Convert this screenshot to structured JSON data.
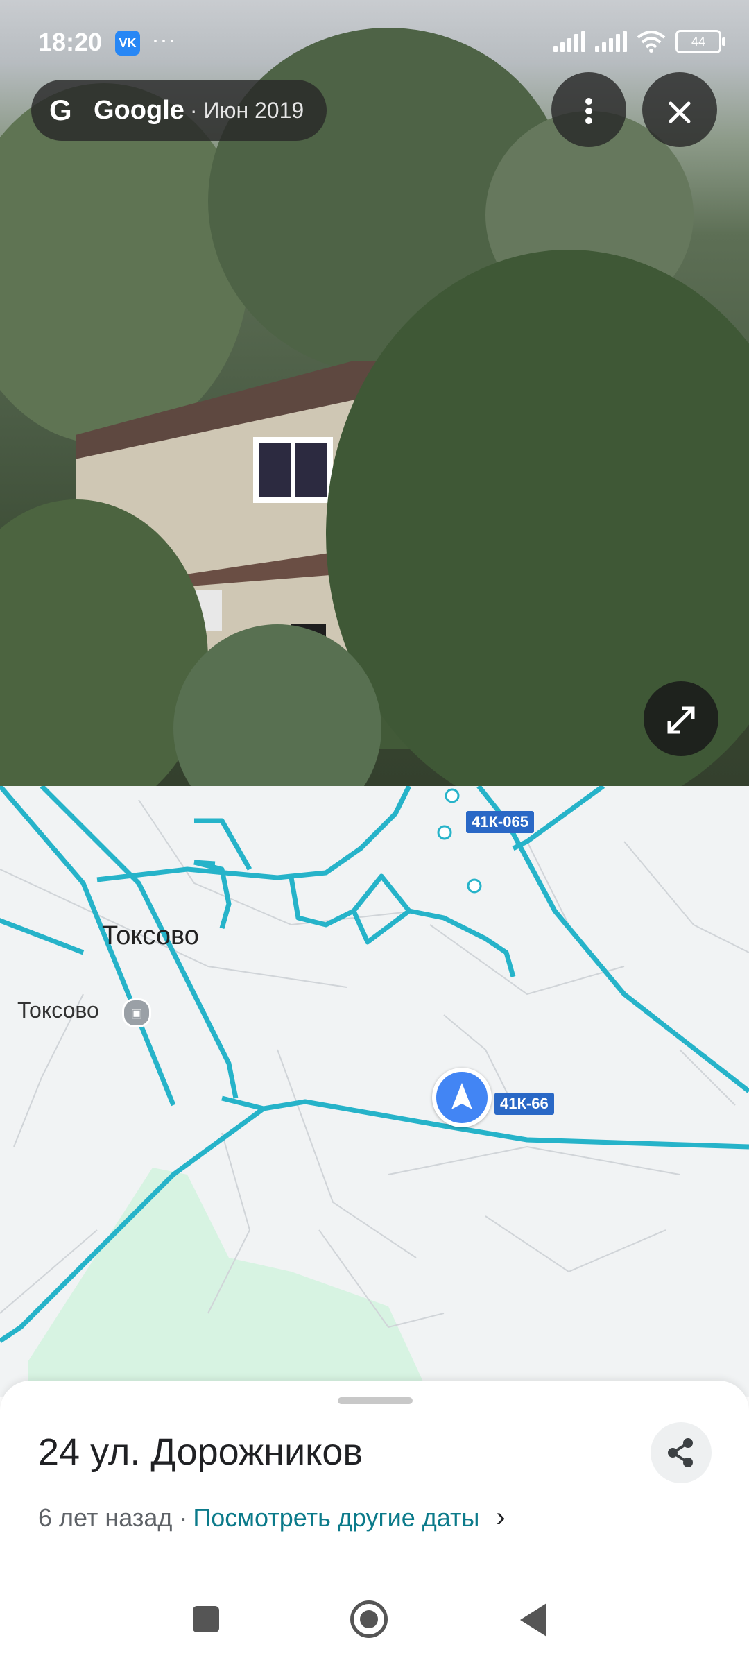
{
  "status_bar": {
    "time": "18:20",
    "vk_icon": "VK",
    "more_dots": "···",
    "battery": "44"
  },
  "street_view": {
    "google_icon": "G",
    "brand": "Google",
    "date": "· Июн 2019"
  },
  "map": {
    "town_label": "Токсово",
    "station_label": "Токсово",
    "road_shield_1": "41К-065",
    "road_shield_2": "41К-66"
  },
  "sheet": {
    "address": "24 ул. Дорожников",
    "time_ago": "6 лет назад ·",
    "other_dates_link": "Посмотреть другие даты",
    "chevron": "›"
  },
  "colors": {
    "road": "#26b3c9",
    "nav_arrow": "#4285f4",
    "link": "#0b7a8a"
  }
}
